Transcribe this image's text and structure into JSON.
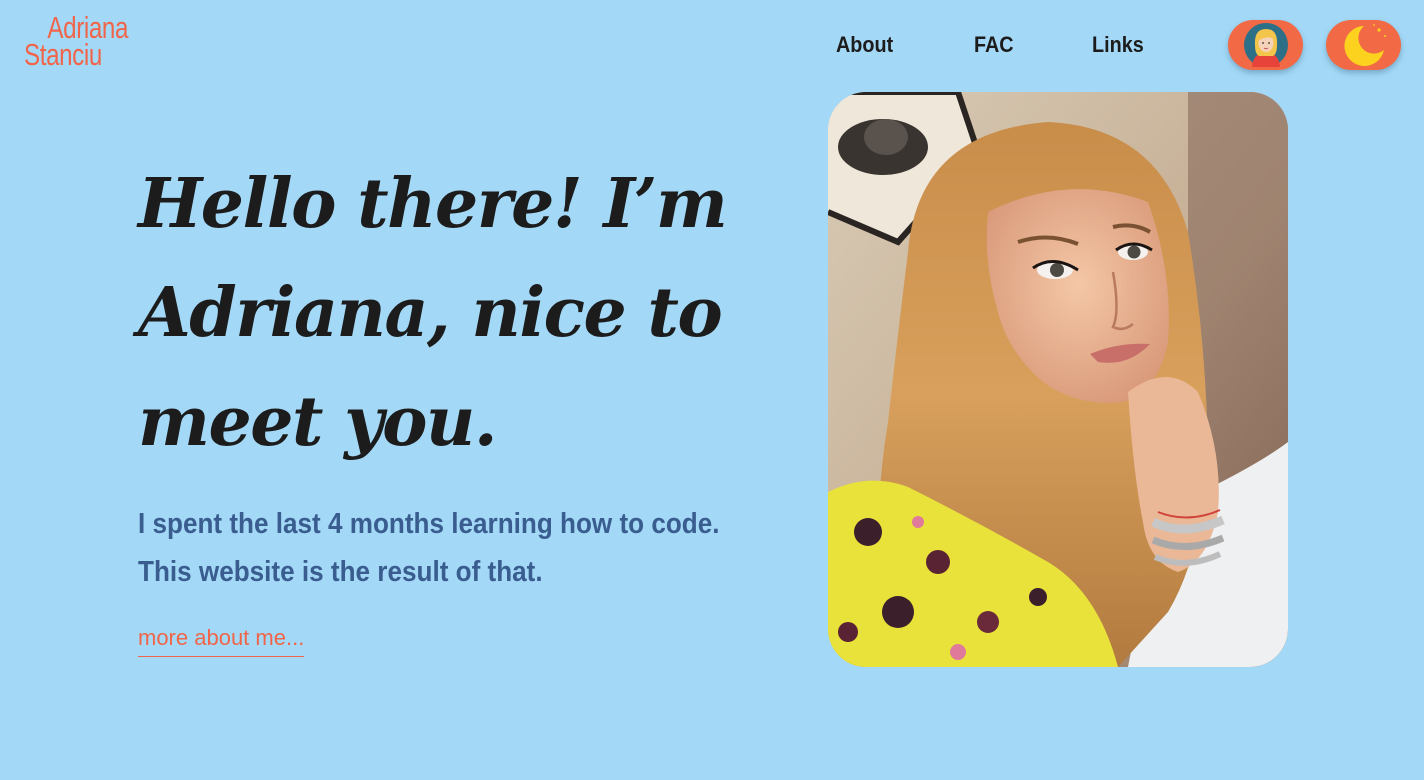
{
  "logo": {
    "line1": "Adriana",
    "line2": "Stanciu"
  },
  "nav": {
    "items": [
      {
        "label": "About"
      },
      {
        "label": "FAC"
      },
      {
        "label": "Links"
      }
    ]
  },
  "toggles": {
    "avatar_icon": "girl-avatar-icon",
    "theme_icon": "moon-icon",
    "color": "#f26a45"
  },
  "hero": {
    "title": "Hello there! I’m Adriana, nice to meet you.",
    "subtitle": "I spent the last 4 months learning how to code. This website is the result of that.",
    "more_link": "more about me..."
  },
  "colors": {
    "background": "#a3d9f7",
    "accent": "#f0654a",
    "title": "#1c1c1c",
    "subtitle": "#3a5d8f"
  }
}
